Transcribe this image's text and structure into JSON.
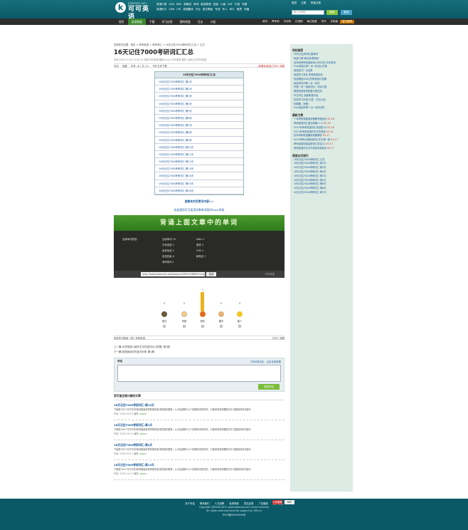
{
  "header": {
    "logo_url": "kekenet.com",
    "logo_name": "可可英语",
    "logo_letter": "k",
    "nav_rows": [
      [
        "英语口语",
        "VOA",
        "BBC",
        "新概念",
        "单词",
        "影视英语",
        "四级",
        "六级",
        "SAT",
        "口语",
        "专题"
      ],
      [
        "英语听力",
        "CNN",
        "CRI",
        "英语翻译",
        "行业",
        "英文歌曲",
        "专四",
        "专八",
        "BEC",
        "雅思",
        "托福"
      ]
    ],
    "top_links": [
      "登录",
      "注册",
      "快速注册"
    ],
    "search_placeholder": "输入关键字",
    "search_button": "搜索",
    "login_button": "登录"
  },
  "navbar": {
    "items": [
      "首页",
      "英语频道",
      "下载",
      "学习应用",
      "我的地盘",
      "日志",
      "小组"
    ],
    "active": "英语频道",
    "right_items": [
      "资讯",
      "青年网",
      "可可网",
      "日语网",
      "每日英语",
      "写作",
      "手机版",
      "官方微博"
    ]
  },
  "article": {
    "breadcrumb": "您现在的位置：首页 > 考研英语 > 考研词汇 > 16天记住7000考研词汇汇总 > 正文",
    "title": "16天记住7000考研词汇汇总",
    "meta": "时间:2009-10-16 13:00:10 来源:可可英语 编辑:sunny 可可英语 官网 | 每天认识可可英语",
    "tools": [
      "评论",
      "收藏",
      "字号: 大 | 中 | 小",
      "PDF文件下载"
    ],
    "tools_right": "[我要找错误] 打印 | 收藏",
    "toc_title": "16天记住7000考研词汇汇总",
    "toc": [
      "· 16天记住7000考研词汇:第1天",
      "· 16天记住7000考研词汇:第2天",
      "· 16天记住7000考研词汇:第3天",
      "· 16天记住7000考研词汇:第4天",
      "· 16天记住7000考研词汇:第5天",
      "· 16天记住7000考研词汇:第6天",
      "· 16天记住7000考研词汇:第7天",
      "· 16天记住7000考研词汇:第8天",
      "· 16天记住7000考研词汇:第9天",
      "· 16天记住7000考研词汇:第10天",
      "· 16天记住7000考研词汇:第11天",
      "· 16天记住7000考研词汇:第12天",
      "· 16天记住7000考研词汇:第13天",
      "· 16天记住7000考研词汇:第14天",
      "· 16天记住7000考研词汇:第15天",
      "· 16天记住7000考研词汇:第16天"
    ],
    "more_link": "查看本栏目更多内容>>",
    "flash_link": "欢迎使用可可英语文章单词滑词Flash系统"
  },
  "widget": {
    "banner": "背诵上面文章中的单词",
    "label": "选择单词类型:",
    "col1": [
      "全部单词 29",
      "中考英语 2",
      "高考英语 5",
      "英语四级 6",
      "考研单词 1"
    ],
    "col2": [
      "MBA 5",
      "雅思 3",
      "GRE 2",
      "新概念 2"
    ],
    "copy_label": "分享给你的朋友:",
    "url": "http://www.kekenet.com/kaoyan/200910/86050.shtml",
    "copy": "复制",
    "brand": "可可英语"
  },
  "mood": [
    {
      "label": "难过",
      "count": "0",
      "level": 0
    },
    {
      "label": "鸡蛋",
      "count": "0",
      "level": 0
    },
    {
      "label": "鲜花",
      "count": "1",
      "level": 1
    },
    {
      "label": "握手",
      "count": "0",
      "level": 0
    },
    {
      "label": "雷人",
      "count": "0",
      "level": 0
    }
  ],
  "tagbar": {
    "left": "相关热词搜索: 词汇 考研英语",
    "right": "打印 | 收藏"
  },
  "prevnext": {
    "prev": "上一篇:大学英语六级作文中的连词(9)(学霸) 第1期",
    "next": "下一篇:英语阅读中的连词分析 第1期"
  },
  "comment": {
    "title": "评论",
    "count": "已有0条评论，点击全部查看",
    "button": "发表评论"
  },
  "related": {
    "title": "您可能还感兴趣的文章",
    "items": [
      {
        "title": "16天记住7000考研词汇:第10天",
        "desc": "下面是784个句子中的单词覆盖考研所需的单词的基本要求。从已经按照\"A-Z\"的顺序来排列的，方便看考研需要的可中文翻译的单词部分",
        "meta_label": "时间: 2009-09-23 编辑:",
        "editor": "sunny"
      },
      {
        "title": "16天记住7000考研词汇:第1天",
        "desc": "下面是784个句子中的单词覆盖考研所需的单词的基本要求。从已经按照\"A-Z\"的顺序来排列的，方便看考研需要的可中文翻译的单词部分",
        "meta_label": "时间: 2009-09-10 编辑:",
        "editor": "sunny"
      },
      {
        "title": "16天记住7000考研词汇:第4天",
        "desc": "下面是784个句子中的单词覆盖考研所需的单词的基本要求。从已经按照\"A-Z\"的顺序来排列的，方便看考研需要的可中文翻译的单词部分",
        "meta_label": "时间: 2009-09-17 编辑:",
        "editor": "sunny"
      },
      {
        "title": "16天记住7000考研词汇:第13天",
        "desc": "下面是784个句子中的单词覆盖考研所需的单词的基本要求。从已经按照\"A-Z\"的顺序来排列的，方便看考研需要的可中文翻译的单词部分",
        "meta_label": "时间: 2009-10-12 编辑:",
        "editor": "sunny"
      }
    ]
  },
  "sidebar": {
    "s1_title": "特别推荐",
    "s1": [
      "· 50天记住考研汇集单词",
      "· 免费订阅\"每日英语测验\"",
      "· 名师讲考研英语阅读16天记住7000单词",
      "· Free英语大赛一对一精讲公开课",
      "· 英语技巧？点这里",
      "· 英语学习专区 考研英语测试",
      "· 免费赠送500元外教免费口语课",
      "· 免费申请外教一对一测评",
      "· 外国一对一免费试听，测试口语",
      "· 美国发现发现发展口语在线",
      "· 外交学生 高级英语对话",
      "· 在线学习外语 口语，方法大全！",
      "· 你需要，来看！",
      "· Free免费外教一对一测评试听"
    ],
    "s2_title": "最新文章",
    "s2": [
      {
        "t": "· 十年考研真题阅读理解专题全析",
        "d": "05-18"
      },
      {
        "t": "· 考研英语词汇重点精解(1-7)",
        "d": "05-18"
      },
      {
        "t": "· 2013年考研英语词汇精讲班(4)",
        "d": "05-18"
      },
      {
        "t": "· 2013年考研英语作文写作提纲",
        "d": "05-18"
      },
      {
        "t": "· 历年考研英语翻译真题解析",
        "d": "05-17"
      },
      {
        "t": "· 2012考研大纲新增词汇作文第一篇",
        "d": "05-17"
      },
      {
        "t": "· 考研英语阅读高频词汇精讲(1)",
        "d": "05-17"
      },
      {
        "t": "· 考研英语作文写作常用句型精讲",
        "d": "05-17"
      }
    ],
    "s3_title": "频道本月排行",
    "s3": [
      "· 16天记住7000考研词汇:汇总",
      "· 16天记住7000考研词汇:第1天",
      "· 16天记住7000考研词汇:第3天",
      "· 16天记住7000考研词汇:第4天",
      "· 16天记住7000考研词汇:第2天",
      "· 16天记住7000考研词汇:第5天",
      "· 16天记住7000考研词汇:第6天",
      "· 16天记住7000考研词汇:第8天",
      "· 16天记住7000考研词汇:第7天"
    ]
  },
  "footer": {
    "links": [
      "关于本站",
      "联系我们",
      "人才招聘",
      "免责条款",
      "意见反馈",
      "广告服务",
      "加入收藏"
    ],
    "copyright": "Copyright @2006-2011 www.kekenet.com online services",
    "rights": "All rights reserved.Security support by 365.cn",
    "icp": "沪ICP备05032650号",
    "badge1": "公安备案",
    "badge2": "BBS"
  }
}
